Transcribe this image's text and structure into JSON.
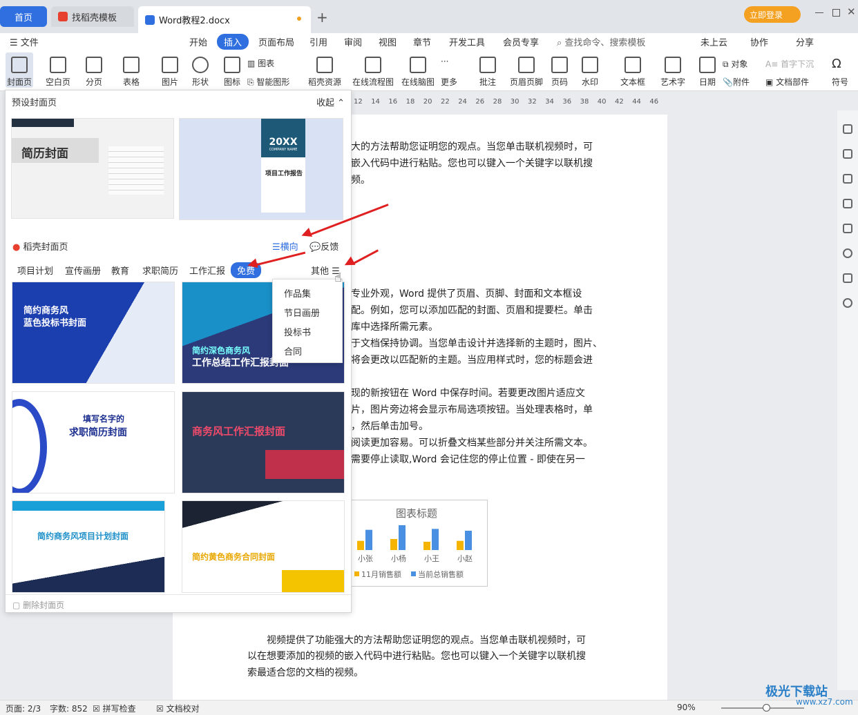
{
  "tabs": {
    "home": "首页",
    "daoke": "找稻壳模板",
    "doc": "Word教程2.docx",
    "login": "立即登录"
  },
  "menu": [
    "文件",
    "开始",
    "插入",
    "页面布局",
    "引用",
    "审阅",
    "视图",
    "章节",
    "开发工具",
    "会员专享"
  ],
  "menu_active": "插入",
  "search_placeholder": "查找命令、搜索模板",
  "menu_right": [
    "未上云",
    "协作",
    "分享"
  ],
  "ribbon": {
    "cover": "封面页",
    "blank": "空白页",
    "break": "分页",
    "table": "表格",
    "picture": "图片",
    "shape": "形状",
    "icon": "图标",
    "chart": "图表",
    "smartart": "智能图形",
    "daoke_res": "稻壳资源",
    "flowchart": "在线流程图",
    "mindmap": "在线脑图",
    "more": "更多",
    "comment": "批注",
    "header_footer": "页眉页脚",
    "page_num": "页码",
    "watermark": "水印",
    "textbox": "文本框",
    "wordart": "艺术字",
    "date": "日期",
    "object": "对象",
    "attach": "附件",
    "dropcap": "首字下沉",
    "docpart": "文档部件",
    "symbol": "符号"
  },
  "ruler_ticks": [
    "12",
    "14",
    "16",
    "18",
    "20",
    "22",
    "24",
    "26",
    "28",
    "30",
    "32",
    "34",
    "36",
    "38",
    "40",
    "42",
    "44",
    "46"
  ],
  "panel": {
    "preset_title": "预设封面页",
    "collapse": "收起",
    "preset_cards": [
      {
        "title": "简历封面"
      },
      {
        "title": "20XX",
        "sub": "COMPANY NAME",
        "caption": "项目工作报告"
      }
    ],
    "daoke_title": "稻壳封面页",
    "landscape": "横向",
    "feedback": "反馈",
    "categories": [
      "项目计划",
      "宣传画册",
      "教育",
      "求职简历",
      "工作汇报",
      "免费"
    ],
    "active_category": "免费",
    "other": "其他",
    "templates": [
      {
        "line1": "简约商务风",
        "line2": "蓝色投标书封面"
      },
      {
        "line1": "简约深色商务风",
        "line2": "工作总结工作汇报封面"
      },
      {
        "line1": "填写名字的",
        "line2": "求职简历封面"
      },
      {
        "line1": "商务风工作汇报封面",
        "line2": ""
      },
      {
        "line1": "简约商务风项目计划封面",
        "line2": ""
      },
      {
        "line1": "简约黄色商务合同封面",
        "line2": ""
      }
    ],
    "delete_cover": "删除封面页"
  },
  "dropdown": [
    "作品集",
    "节日画册",
    "投标书",
    "合同"
  ],
  "document": {
    "lines": [
      "大的方法帮助您证明您的观点。当您单击联机视频时，可",
      "嵌入代码中进行粘贴。您也可以键入一个关键字以联机搜",
      "频。",
      "专业外观，Word 提供了页眉、页脚、封面和文本框设",
      "配。例如，您可以添加匹配的封面、页眉和提要栏。单击",
      "库中选择所需元素。",
      "于文档保持协调。当您单击设计并选择新的主题时，图片、",
      "将会更改以匹配新的主题。当应用样式时，您的标题会进",
      "现的新按钮在 Word 中保存时间。若要更改图片适应文",
      "片，图片旁边将会显示布局选项按钮。当处理表格时，单",
      "，然后单击加号。",
      "阅读更加容易。可以折叠文档某些部分并关注所需文本。",
      "需要停止读取,Word 会记住您的停止位置 - 即使在另一",
      "视频提供了功能强大的方法帮助您证明您的观点。当您单击联机视频时，可",
      "以在想要添加的视频的嵌入代码中进行粘贴。您也可以键入一个关键字以联机搜",
      "索最适合您的文档的视频。"
    ]
  },
  "chart_data": {
    "type": "bar",
    "title": "图表标题",
    "categories": [
      "小张",
      "小杨",
      "小王",
      "小赵"
    ],
    "series": [
      {
        "name": "11月销售额",
        "color": "#f5b400",
        "values": [
          1.0,
          1.2,
          0.9,
          1.0
        ]
      },
      {
        "name": "当前总销售额",
        "color": "#4a90e2",
        "values": [
          2.2,
          2.7,
          2.3,
          2.1
        ]
      }
    ]
  },
  "status": {
    "page": "页面: 2/3",
    "words": "字数: 852",
    "spell": "拼写检查",
    "proof": "文档校对",
    "zoom": "90%"
  },
  "watermark": {
    "brand": "极光下载站",
    "url": "www.xz7.com"
  }
}
